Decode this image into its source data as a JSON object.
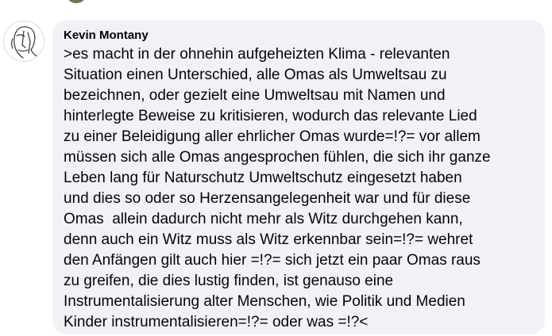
{
  "comment": {
    "author": "Kevin Montany",
    "text": ">es macht in der ohnehin aufgeheizten Klima - relevanten\nSituation einen Unterschied, alle Omas als Umweltsau zu\nbezeichnen, oder gezielt eine Umweltsau mit Namen und\nhinterlegte Beweise zu kritisieren, wodurch das relevante Lied\nzu einer Beleidigung aller ehrlicher Omas wurde=!?= vor allem\nmüssen sich alle Omas angesprochen fühlen, die sich ihr ganze\nLeben lang für Naturschutz Umweltschutz eingesetzt haben\nund dies so oder so Herzensangelegenheit war und für diese\nOmas  allein dadurch nicht mehr als Witz durchgehen kann,\ndenn auch ein Witz muss als Witz erkennbar sein=!?= wehret\nden Anfängen gilt auch hier =!?= sich jetzt ein paar Omas raus\nzu greifen, die dies lustig finden, ist genauso eine\nInstrumentalisierung alter Menschen, wie Politik und Medien\nKinder instrumentalisieren=!?= oder was =!?<",
    "avatar_icon": "sketch-face-avatar-icon"
  },
  "colors": {
    "bubble_background": "#f0f2f5",
    "text": "#050505"
  }
}
